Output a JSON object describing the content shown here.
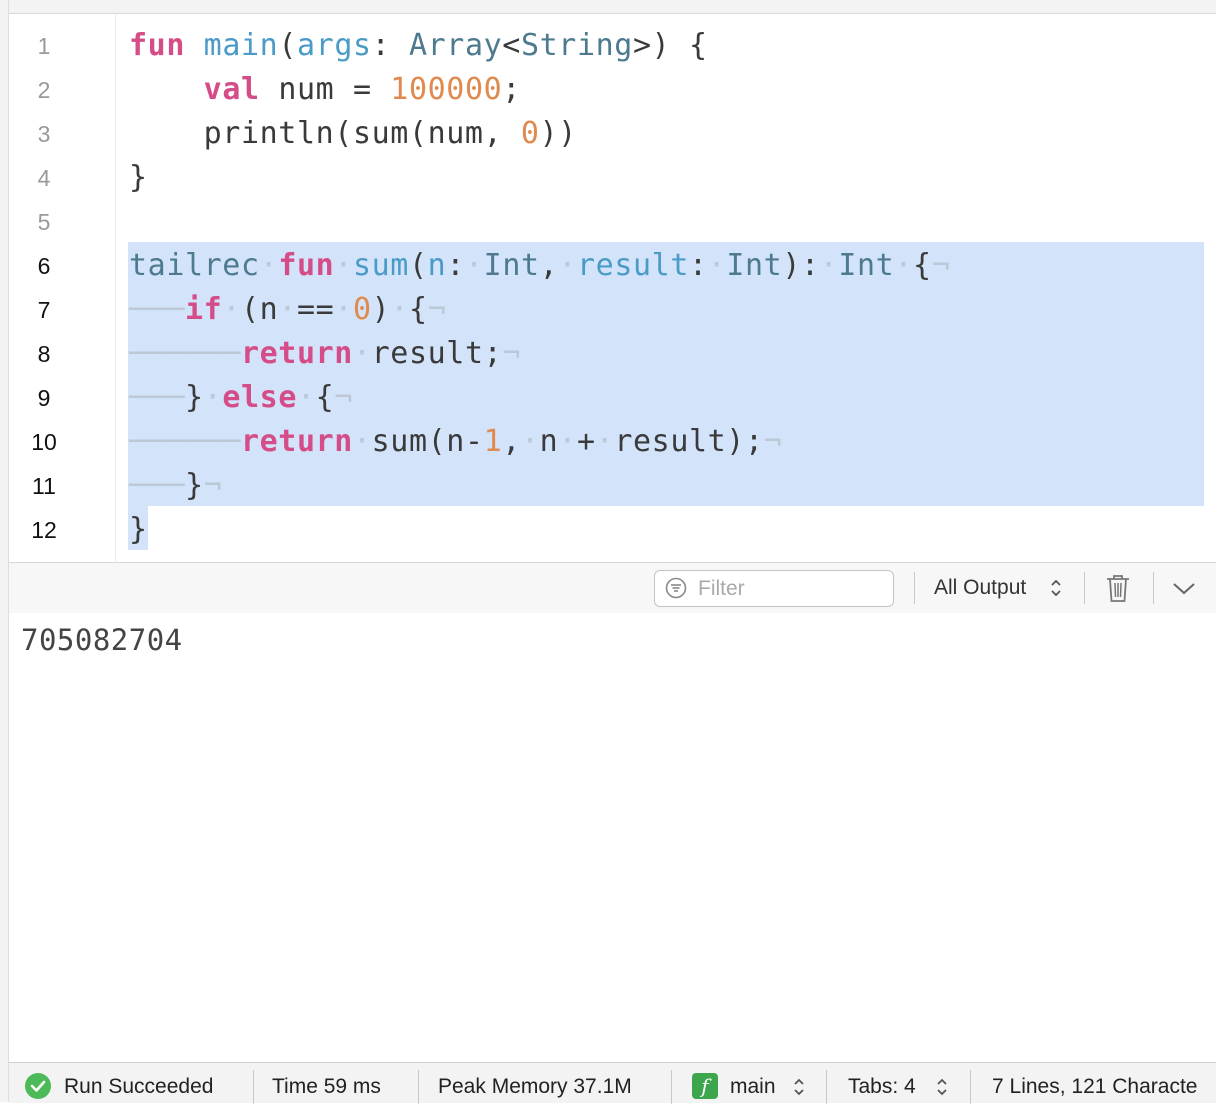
{
  "editor": {
    "lines": [
      {
        "num": "1"
      },
      {
        "num": "2"
      },
      {
        "num": "3"
      },
      {
        "num": "4"
      },
      {
        "num": "5"
      },
      {
        "num": "6"
      },
      {
        "num": "7"
      },
      {
        "num": "8"
      },
      {
        "num": "9"
      },
      {
        "num": "10"
      },
      {
        "num": "11"
      },
      {
        "num": "12"
      }
    ]
  },
  "toolbar": {
    "filter_placeholder": "Filter",
    "output_select": "All Output"
  },
  "console": {
    "output": "705082704"
  },
  "status": {
    "run_status": "Run Succeeded",
    "time": "Time 59 ms",
    "peak_memory": "Peak Memory 37.1M",
    "function_badge": "f",
    "function_name": "main",
    "tabs": "Tabs: 4",
    "summary": "7 Lines, 121 Characte"
  },
  "colors": {
    "keyword": "#d44d88",
    "function": "#4a9bc8",
    "type": "#4d7a8f",
    "number": "#e08a4f",
    "selection": "#d3e4fa",
    "success": "#4cba58"
  }
}
